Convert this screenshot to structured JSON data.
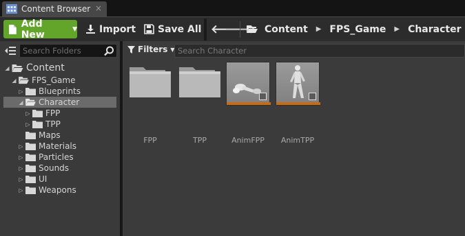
{
  "tab": {
    "title": "Content Browser",
    "close_glyph": "×",
    "icon": "content-browser-icon"
  },
  "toolbar": {
    "add_new_label": "Add New",
    "import_label": "Import",
    "save_all_label": "Save All",
    "back_glyph": "🡐",
    "forward_glyph": "🡒"
  },
  "breadcrumbs": [
    {
      "label": "Content"
    },
    {
      "label": "FPS_Game"
    },
    {
      "label": "Character"
    }
  ],
  "folder_panel": {
    "search_placeholder": "Search Folders",
    "tree": [
      {
        "label": "Content",
        "expanded": true,
        "selected": false
      },
      {
        "label": "FPS_Game",
        "expanded": true,
        "selected": false
      },
      {
        "label": "Blueprints",
        "expanded": false,
        "selected": false
      },
      {
        "label": "Character",
        "expanded": true,
        "selected": true
      },
      {
        "label": "FPP",
        "expanded": false,
        "selected": false
      },
      {
        "label": "TPP",
        "expanded": false,
        "selected": false
      },
      {
        "label": "Maps",
        "expanded": false,
        "selected": false
      },
      {
        "label": "Materials",
        "expanded": false,
        "selected": false
      },
      {
        "label": "Particles",
        "expanded": false,
        "selected": false
      },
      {
        "label": "Sounds",
        "expanded": false,
        "selected": false
      },
      {
        "label": "UI",
        "expanded": false,
        "selected": false
      },
      {
        "label": "Weapons",
        "expanded": false,
        "selected": false
      }
    ]
  },
  "asset_panel": {
    "filters_label": "Filters",
    "search_placeholder": "Search Character",
    "assets": [
      {
        "name": "FPP",
        "kind": "folder"
      },
      {
        "name": "TPP",
        "kind": "folder"
      },
      {
        "name": "AnimFPP",
        "kind": "animation"
      },
      {
        "name": "AnimTPP",
        "kind": "animation"
      }
    ]
  },
  "colors": {
    "add_new_green": "#63a52a",
    "selected_row": "#6b6b6b",
    "animation_accent": "#c96b10"
  }
}
